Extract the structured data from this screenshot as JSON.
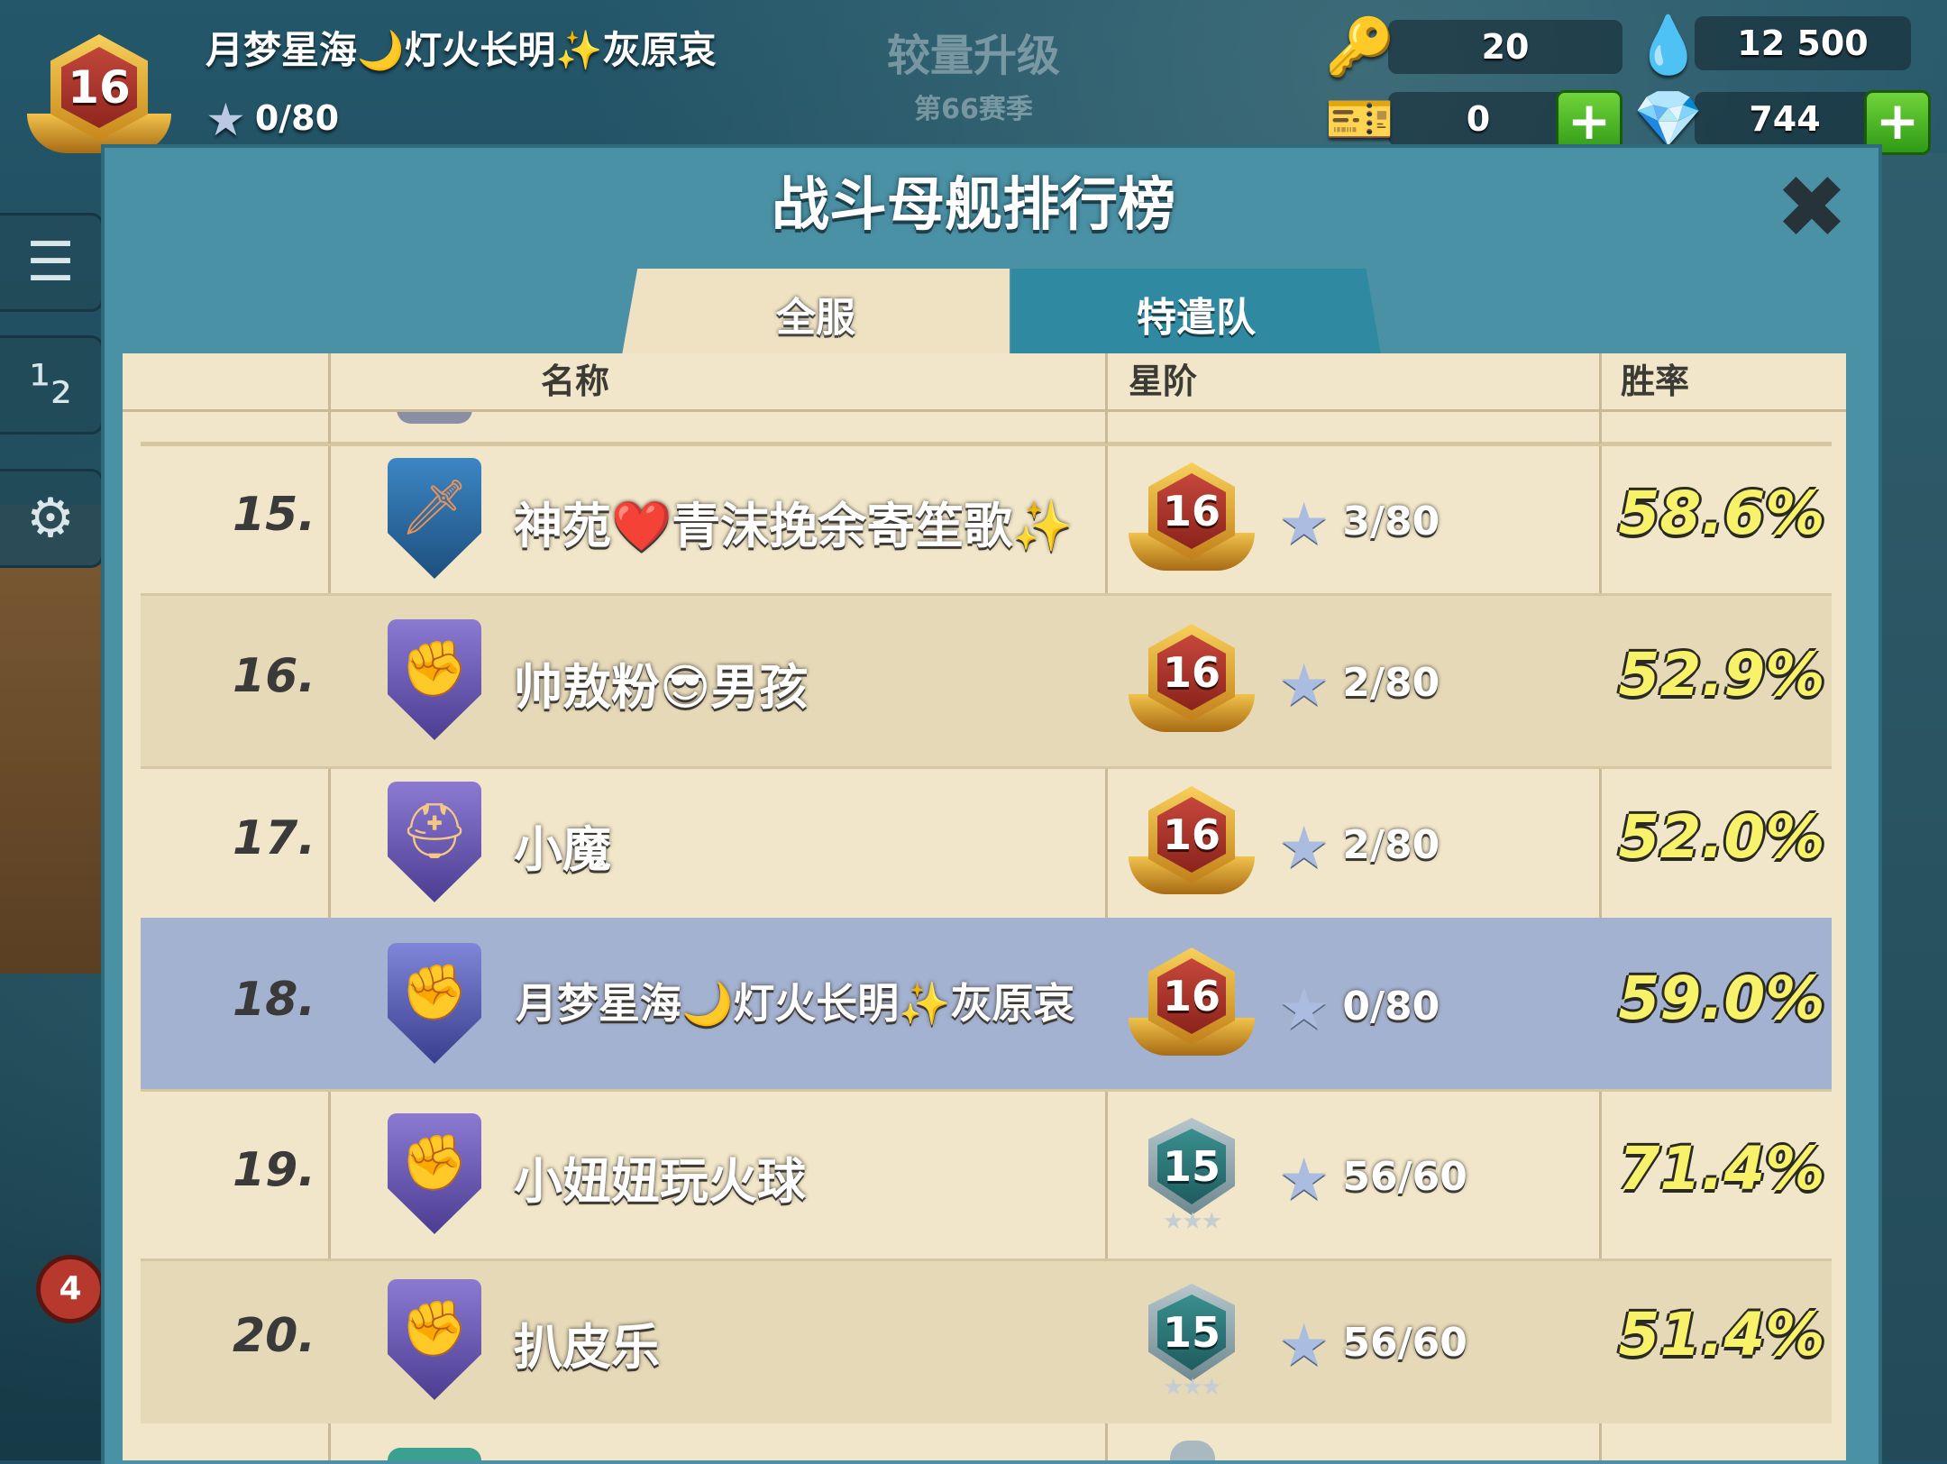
{
  "player": {
    "level": "16",
    "name": "月梦星海🌙灯火长明✨灰原哀",
    "stars": "0/80"
  },
  "season": {
    "title": "较量升级",
    "subtitle": "第66赛季"
  },
  "resources": {
    "keys": "20",
    "intel": "12 500",
    "tickets": "0",
    "diamonds": "744"
  },
  "icons": {
    "key": "key-icon",
    "intel": "intel-drop-icon",
    "ticket": "ticket-icon",
    "diamond": "diamond-icon",
    "plus": "plus-icon",
    "close": "close-icon",
    "star": "star-icon"
  },
  "panel": {
    "title": "战斗母舰排行榜",
    "close_label": "✖",
    "tabs": [
      {
        "label": "全服",
        "active": true
      },
      {
        "label": "特遣队",
        "active": false
      }
    ],
    "headers": {
      "name": "名称",
      "rank_level": "星阶",
      "winrate": "胜率"
    }
  },
  "sidebar": {
    "menu_icon": "☰",
    "rank_icon": "¹₂",
    "settings_icon": "⚙",
    "badge_count": "4"
  },
  "leaderboard": [
    {
      "rank": "15.",
      "name": "神苑❤️青沫挽余寄笙歌✨",
      "level": "16",
      "level_style": "gold",
      "stars": "3/80",
      "winrate": "58.6%",
      "emblem": "sword",
      "emblem_color": "blue"
    },
    {
      "rank": "16.",
      "name": "帅敖粉😎男孩",
      "level": "16",
      "level_style": "gold",
      "stars": "2/80",
      "winrate": "52.9%",
      "emblem": "fist",
      "emblem_color": "purple"
    },
    {
      "rank": "17.",
      "name": "小魔",
      "level": "16",
      "level_style": "gold",
      "stars": "2/80",
      "winrate": "52.0%",
      "emblem": "helmet",
      "emblem_color": "purple"
    },
    {
      "rank": "18.",
      "name": "月梦星海🌙灯火长明✨灰原哀",
      "level": "16",
      "level_style": "gold",
      "stars": "0/80",
      "winrate": "59.0%",
      "emblem": "fist",
      "emblem_color": "purple",
      "is_current_player": true
    },
    {
      "rank": "19.",
      "name": "小妞妞玩火球",
      "level": "15",
      "level_style": "teal",
      "stars": "56/60",
      "winrate": "71.4%",
      "emblem": "fist",
      "emblem_color": "purple"
    },
    {
      "rank": "20.",
      "name": "扒皮乐",
      "level": "15",
      "level_style": "teal",
      "stars": "56/60",
      "winrate": "51.4%",
      "emblem": "fist",
      "emblem_color": "purple"
    }
  ]
}
